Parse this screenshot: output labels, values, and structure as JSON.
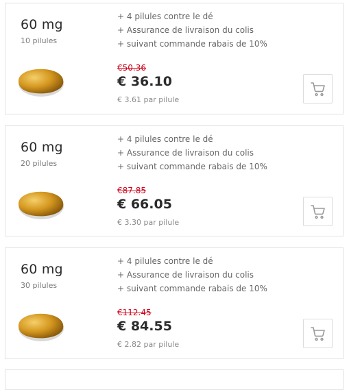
{
  "offers": [
    {
      "dose": "60 mg",
      "count": "10 pilules",
      "features": [
        "4 pilules contre le dé",
        "Assurance de livraison du colis",
        "suivant commande rabais de 10%"
      ],
      "old_price": "€50.36",
      "price": "€ 36.10",
      "per_unit": "€ 3.61 par pilule"
    },
    {
      "dose": "60 mg",
      "count": "20 pilules",
      "features": [
        "4 pilules contre le dé",
        "Assurance de livraison du colis",
        "suivant commande rabais de 10%"
      ],
      "old_price": "€87.85",
      "price": "€ 66.05",
      "per_unit": "€ 3.30 par pilule"
    },
    {
      "dose": "60 mg",
      "count": "30 pilules",
      "features": [
        "4 pilules contre le dé",
        "Assurance de livraison du colis",
        "suivant commande rabais de 10%"
      ],
      "old_price": "€112.45",
      "price": "€ 84.55",
      "per_unit": "€ 2.82 par pilule"
    }
  ],
  "colors": {
    "accent_old_price": "#d0021b",
    "border": "#e3e3e3",
    "pill_gold": "#d4971f"
  },
  "icons": {
    "cart": "shopping-cart-icon",
    "pill": "pill-image"
  }
}
